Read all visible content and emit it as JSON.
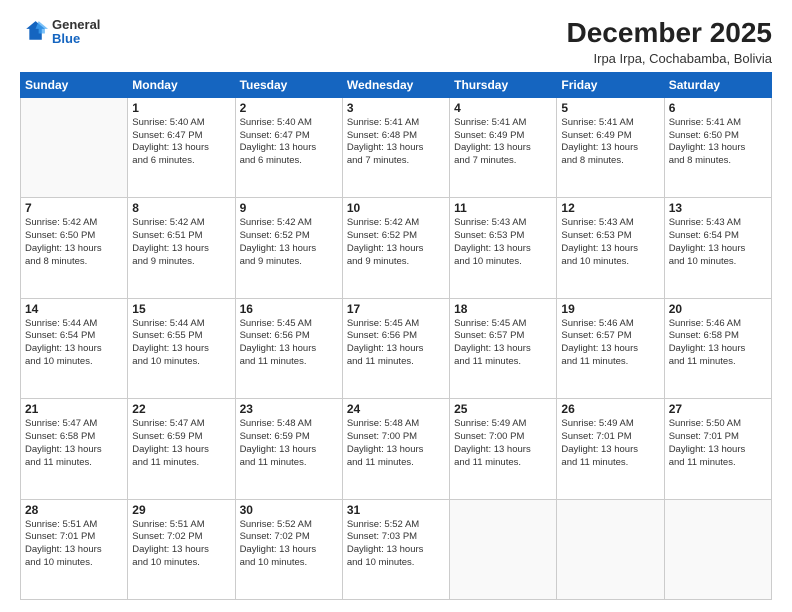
{
  "logo": {
    "general": "General",
    "blue": "Blue"
  },
  "title": "December 2025",
  "location": "Irpa Irpa, Cochabamba, Bolivia",
  "days_of_week": [
    "Sunday",
    "Monday",
    "Tuesday",
    "Wednesday",
    "Thursday",
    "Friday",
    "Saturday"
  ],
  "weeks": [
    [
      {
        "day": "",
        "info": ""
      },
      {
        "day": "1",
        "info": "Sunrise: 5:40 AM\nSunset: 6:47 PM\nDaylight: 13 hours\nand 6 minutes."
      },
      {
        "day": "2",
        "info": "Sunrise: 5:40 AM\nSunset: 6:47 PM\nDaylight: 13 hours\nand 6 minutes."
      },
      {
        "day": "3",
        "info": "Sunrise: 5:41 AM\nSunset: 6:48 PM\nDaylight: 13 hours\nand 7 minutes."
      },
      {
        "day": "4",
        "info": "Sunrise: 5:41 AM\nSunset: 6:49 PM\nDaylight: 13 hours\nand 7 minutes."
      },
      {
        "day": "5",
        "info": "Sunrise: 5:41 AM\nSunset: 6:49 PM\nDaylight: 13 hours\nand 8 minutes."
      },
      {
        "day": "6",
        "info": "Sunrise: 5:41 AM\nSunset: 6:50 PM\nDaylight: 13 hours\nand 8 minutes."
      }
    ],
    [
      {
        "day": "7",
        "info": "Sunrise: 5:42 AM\nSunset: 6:50 PM\nDaylight: 13 hours\nand 8 minutes."
      },
      {
        "day": "8",
        "info": "Sunrise: 5:42 AM\nSunset: 6:51 PM\nDaylight: 13 hours\nand 9 minutes."
      },
      {
        "day": "9",
        "info": "Sunrise: 5:42 AM\nSunset: 6:52 PM\nDaylight: 13 hours\nand 9 minutes."
      },
      {
        "day": "10",
        "info": "Sunrise: 5:42 AM\nSunset: 6:52 PM\nDaylight: 13 hours\nand 9 minutes."
      },
      {
        "day": "11",
        "info": "Sunrise: 5:43 AM\nSunset: 6:53 PM\nDaylight: 13 hours\nand 10 minutes."
      },
      {
        "day": "12",
        "info": "Sunrise: 5:43 AM\nSunset: 6:53 PM\nDaylight: 13 hours\nand 10 minutes."
      },
      {
        "day": "13",
        "info": "Sunrise: 5:43 AM\nSunset: 6:54 PM\nDaylight: 13 hours\nand 10 minutes."
      }
    ],
    [
      {
        "day": "14",
        "info": "Sunrise: 5:44 AM\nSunset: 6:54 PM\nDaylight: 13 hours\nand 10 minutes."
      },
      {
        "day": "15",
        "info": "Sunrise: 5:44 AM\nSunset: 6:55 PM\nDaylight: 13 hours\nand 10 minutes."
      },
      {
        "day": "16",
        "info": "Sunrise: 5:45 AM\nSunset: 6:56 PM\nDaylight: 13 hours\nand 11 minutes."
      },
      {
        "day": "17",
        "info": "Sunrise: 5:45 AM\nSunset: 6:56 PM\nDaylight: 13 hours\nand 11 minutes."
      },
      {
        "day": "18",
        "info": "Sunrise: 5:45 AM\nSunset: 6:57 PM\nDaylight: 13 hours\nand 11 minutes."
      },
      {
        "day": "19",
        "info": "Sunrise: 5:46 AM\nSunset: 6:57 PM\nDaylight: 13 hours\nand 11 minutes."
      },
      {
        "day": "20",
        "info": "Sunrise: 5:46 AM\nSunset: 6:58 PM\nDaylight: 13 hours\nand 11 minutes."
      }
    ],
    [
      {
        "day": "21",
        "info": "Sunrise: 5:47 AM\nSunset: 6:58 PM\nDaylight: 13 hours\nand 11 minutes."
      },
      {
        "day": "22",
        "info": "Sunrise: 5:47 AM\nSunset: 6:59 PM\nDaylight: 13 hours\nand 11 minutes."
      },
      {
        "day": "23",
        "info": "Sunrise: 5:48 AM\nSunset: 6:59 PM\nDaylight: 13 hours\nand 11 minutes."
      },
      {
        "day": "24",
        "info": "Sunrise: 5:48 AM\nSunset: 7:00 PM\nDaylight: 13 hours\nand 11 minutes."
      },
      {
        "day": "25",
        "info": "Sunrise: 5:49 AM\nSunset: 7:00 PM\nDaylight: 13 hours\nand 11 minutes."
      },
      {
        "day": "26",
        "info": "Sunrise: 5:49 AM\nSunset: 7:01 PM\nDaylight: 13 hours\nand 11 minutes."
      },
      {
        "day": "27",
        "info": "Sunrise: 5:50 AM\nSunset: 7:01 PM\nDaylight: 13 hours\nand 11 minutes."
      }
    ],
    [
      {
        "day": "28",
        "info": "Sunrise: 5:51 AM\nSunset: 7:01 PM\nDaylight: 13 hours\nand 10 minutes."
      },
      {
        "day": "29",
        "info": "Sunrise: 5:51 AM\nSunset: 7:02 PM\nDaylight: 13 hours\nand 10 minutes."
      },
      {
        "day": "30",
        "info": "Sunrise: 5:52 AM\nSunset: 7:02 PM\nDaylight: 13 hours\nand 10 minutes."
      },
      {
        "day": "31",
        "info": "Sunrise: 5:52 AM\nSunset: 7:03 PM\nDaylight: 13 hours\nand 10 minutes."
      },
      {
        "day": "",
        "info": ""
      },
      {
        "day": "",
        "info": ""
      },
      {
        "day": "",
        "info": ""
      }
    ]
  ]
}
